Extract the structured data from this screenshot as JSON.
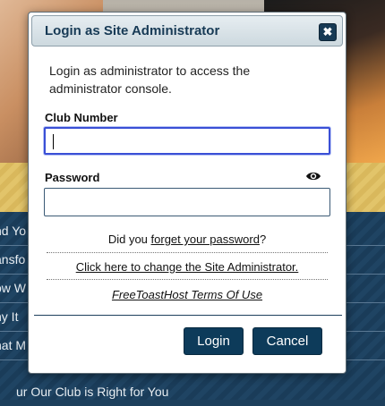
{
  "background": {
    "nav_items": [
      "nd Yo",
      "ansfo",
      "ow W",
      "ny It",
      "hat M",
      "ur Our Club is Right for You"
    ]
  },
  "dialog": {
    "title": "Login as Site Administrator",
    "close_icon": "close-icon",
    "intro": "Login as administrator to access the administrator console.",
    "club_number": {
      "label": "Club Number",
      "value": "",
      "placeholder": ""
    },
    "password": {
      "label": "Password",
      "value": "",
      "placeholder": "",
      "toggle_icon": "eye-icon"
    },
    "forgot": {
      "prefix": "Did you ",
      "link": "forget your password",
      "suffix": "?"
    },
    "change_admin_link": "Click here to change the Site Administrator.",
    "terms_link": "FreeToastHost Terms Of Use",
    "buttons": {
      "login": "Login",
      "cancel": "Cancel"
    }
  },
  "colors": {
    "primary": "#0d3b5a",
    "title_text": "#173a55",
    "focus_border": "#3a4fd6"
  }
}
